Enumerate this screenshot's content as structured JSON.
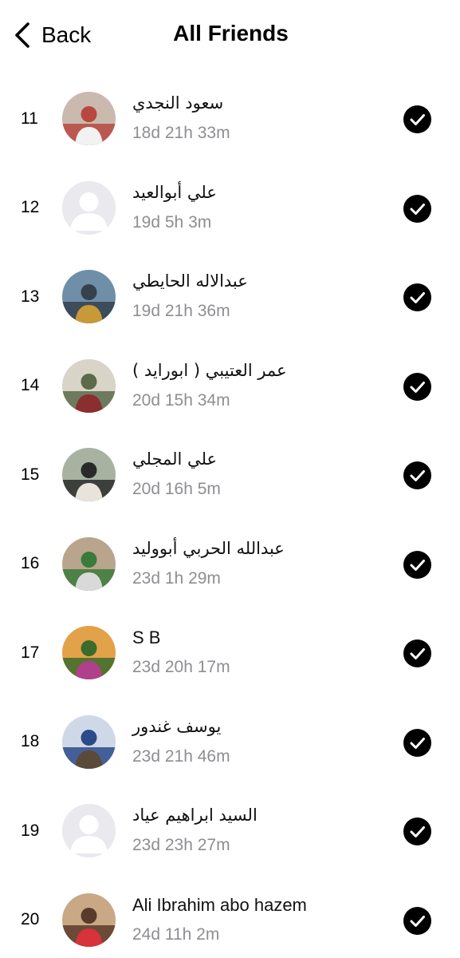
{
  "header": {
    "back_label": "Back",
    "title": "All Friends"
  },
  "friends": [
    {
      "rank": "11",
      "name": "سعود النجدي",
      "time": "18d 21h 33m",
      "avatar": "photo-man-red-headscarf",
      "colors": [
        "#c9b9ae",
        "#b8473f",
        "#f2f2f2"
      ]
    },
    {
      "rank": "12",
      "name": "علي أبوالعيد",
      "time": "19d 5h 3m",
      "avatar": "default-avatar",
      "colors": [
        "#e9e9ee",
        "#ffffff"
      ]
    },
    {
      "rank": "13",
      "name": "عبدالاله الحايطي",
      "time": "19d 21h 36m",
      "avatar": "photo-man-with-falcon-perch",
      "colors": [
        "#6f8fa8",
        "#35414d",
        "#c79a37"
      ]
    },
    {
      "rank": "14",
      "name": "عمر العتيبي ( ابورايد )",
      "time": "20d 15h 34m",
      "avatar": "photo-group-outdoor",
      "colors": [
        "#d9d4c8",
        "#5a6a4a",
        "#8a2e2e"
      ]
    },
    {
      "rank": "15",
      "name": "علي المجلي",
      "time": "20d 16h 5m",
      "avatar": "photo-man-by-road",
      "colors": [
        "#a7b3a0",
        "#2a2a2a",
        "#e8e4dc"
      ]
    },
    {
      "rank": "16",
      "name": "عبدالله الحربي أبووليد",
      "time": "23d 1h 29m",
      "avatar": "photo-runner-crowd",
      "colors": [
        "#b9a58d",
        "#3a7a3a",
        "#d9d9d9"
      ]
    },
    {
      "rank": "17",
      "name": "S B",
      "time": "23d 20h 17m",
      "avatar": "photo-sunset-flowers",
      "colors": [
        "#e2a24a",
        "#3a6b2a",
        "#b0408a"
      ]
    },
    {
      "rank": "18",
      "name": "يوسف غندور",
      "time": "23d 21h 46m",
      "avatar": "photo-group-banner",
      "colors": [
        "#cfd8e6",
        "#2b4a8a",
        "#5a4a3a"
      ]
    },
    {
      "rank": "19",
      "name": "السيد ابراهيم عياد",
      "time": "23d 23h 27m",
      "avatar": "default-avatar",
      "colors": [
        "#e9e9ee",
        "#ffffff"
      ]
    },
    {
      "rank": "20",
      "name": "Ali Ibrahim abo hazem",
      "time": "24d 11h 2m",
      "avatar": "photo-man-selfie",
      "colors": [
        "#c9a886",
        "#5a3a2a",
        "#d6333a"
      ]
    }
  ]
}
